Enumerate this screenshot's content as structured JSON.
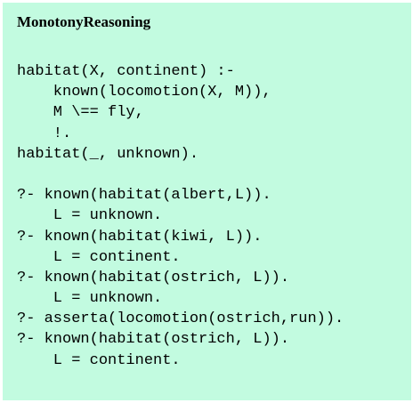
{
  "title": "MonotonyReasoning",
  "code_lines": [
    "habitat(X, continent) :-",
    "    known(locomotion(X, M)),",
    "    M \\== fly,",
    "    !.",
    "habitat(_, unknown).",
    "",
    "?- known(habitat(albert,L)).",
    "    L = unknown.",
    "?- known(habitat(kiwi, L)).",
    "    L = continent.",
    "?- known(habitat(ostrich, L)).",
    "    L = unknown.",
    "?- asserta(locomotion(ostrich,run)).",
    "?- known(habitat(ostrich, L)).",
    "    L = continent."
  ],
  "colors": {
    "panel_background": "#c2fbe0",
    "text": "#000000"
  }
}
